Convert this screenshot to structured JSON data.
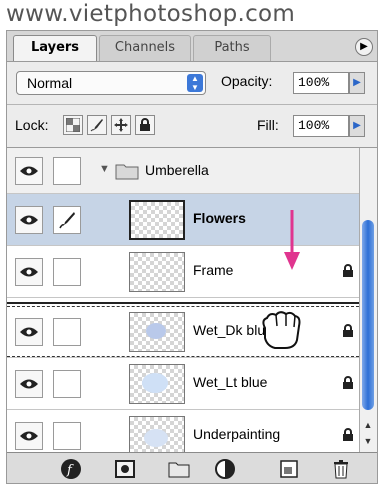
{
  "watermark": "www.vietphotoshop.com",
  "tabs": [
    {
      "label": "Layers",
      "active": true
    },
    {
      "label": "Channels",
      "active": false
    },
    {
      "label": "Paths",
      "active": false
    }
  ],
  "panel_menu_icon": "right-triangle-in-circle",
  "blend_mode": "Normal",
  "opacity_label": "Opacity:",
  "opacity_value": "100%",
  "lock_label": "Lock:",
  "fill_label": "Fill:",
  "fill_value": "100%",
  "lock_icons": [
    "checker-transparency-icon",
    "brush-icon",
    "move-icon",
    "padlock-icon"
  ],
  "layers": [
    {
      "name": "Umberella",
      "type": "group",
      "expanded": true,
      "visible": true
    },
    {
      "name": "Flowers",
      "selected": true,
      "visible": true,
      "linked_icon": "brush-icon"
    },
    {
      "name": "Frame",
      "visible": true,
      "locked": true
    },
    {
      "name": "Wet_Dk blue",
      "visible": true,
      "locked": true
    },
    {
      "name": "Wet_Lt blue",
      "visible": true,
      "locked": true
    },
    {
      "name": "Underpainting",
      "visible": true,
      "locked": true
    }
  ],
  "colors": {
    "selection": "#c6d4e6",
    "accent_blue": "#3c78d8",
    "drag_arrow": "#e0358f"
  },
  "bottom_icons": [
    "layer-style-icon",
    "mask-icon",
    "new-group-icon",
    "adjustment-layer-icon",
    "new-layer-icon",
    "trash-icon"
  ]
}
